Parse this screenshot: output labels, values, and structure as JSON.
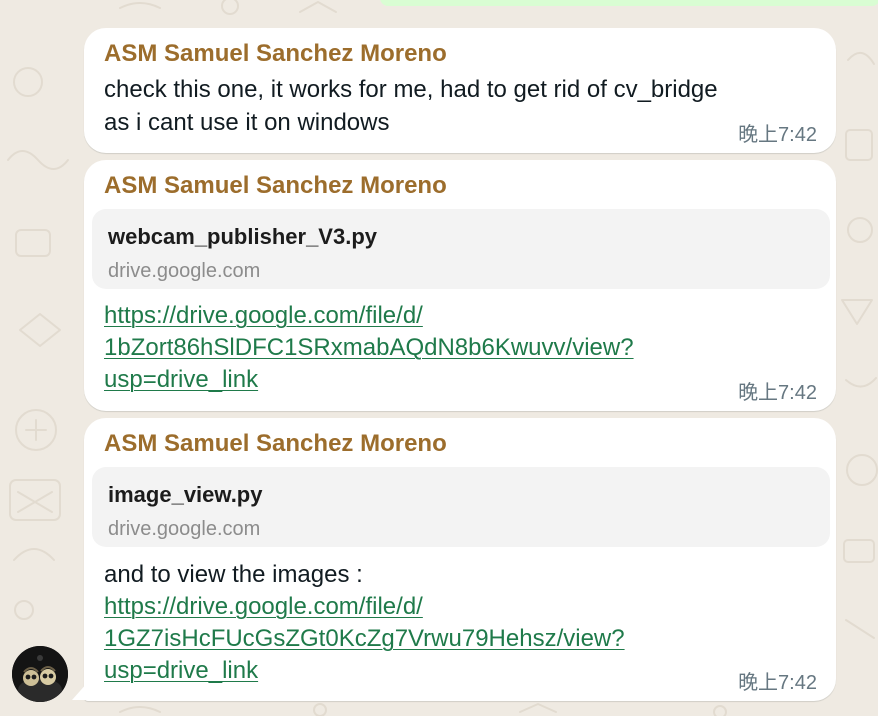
{
  "theme": {
    "chat_background": "#efeae2",
    "bubble_background": "#ffffff",
    "sender_color": "#9c6d2c",
    "link_color": "#1f7a4a",
    "timestamp_color": "#667781",
    "preview_background": "#f3f3f3"
  },
  "messages": [
    {
      "sender": "ASM Samuel Sanchez Moreno",
      "text_lines": [
        "check this one, it works for me, had to get rid of cv_bridge",
        "as i cant use it on windows"
      ],
      "time": "晚上7:42"
    },
    {
      "sender": "ASM Samuel Sanchez Moreno",
      "preview": {
        "title": "webcam_publisher_V3.py",
        "domain": "drive.google.com"
      },
      "link_lines": [
        "https://drive.google.com/file/d/",
        "1bZort86hSlDFC1SRxmabAQdN8b6Kwuvv/view?",
        "usp=drive_link"
      ],
      "time": "晚上7:42"
    },
    {
      "sender": "ASM Samuel Sanchez Moreno",
      "preview": {
        "title": "image_view.py",
        "domain": "drive.google.com"
      },
      "text_lines": [
        "and to view the images :"
      ],
      "link_lines": [
        "https://drive.google.com/file/d/",
        "1GZ7isHcFUcGsZGt0KcZg7Vrwu79Hehsz/view?",
        "usp=drive_link"
      ],
      "time": "晚上7:42"
    }
  ],
  "icons": {
    "wallpaper": "doodle-pattern",
    "avatar": "sender-avatar"
  }
}
